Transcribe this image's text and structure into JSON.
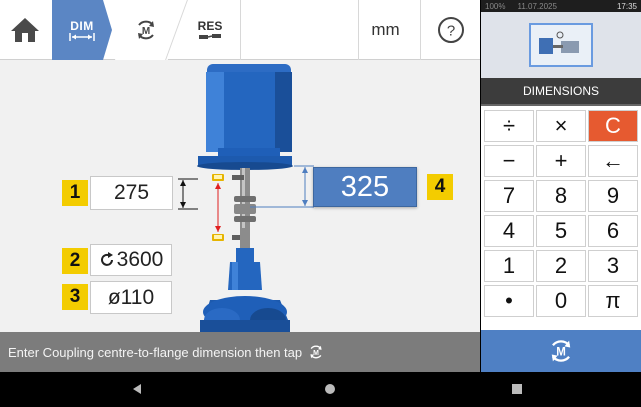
{
  "toolbar": {
    "home_icon": "home-icon",
    "dim_label": "DIM",
    "res_label": "RES",
    "unit": "mm",
    "help_label": "?"
  },
  "fields": [
    {
      "number": "1",
      "value": "275"
    },
    {
      "number": "2",
      "value": "3600"
    },
    {
      "number": "3",
      "value": "ø110"
    },
    {
      "number": "4",
      "value": "325"
    }
  ],
  "status_text": "Enter Coupling centre-to-flange dimension then tap",
  "right_panel": {
    "system": {
      "battery": "100%",
      "date": "11.07.2025",
      "time": "17:35"
    },
    "title": "DIMENSIONS",
    "keys": [
      "÷",
      "×",
      "C",
      "−",
      "+",
      "←",
      "7",
      "8",
      "9",
      "4",
      "5",
      "6",
      "1",
      "2",
      "3",
      "•",
      "0",
      "π"
    ]
  },
  "colors": {
    "accent_blue": "#4f7ec0",
    "badge_yellow": "#f3cc00",
    "clear_key": "#e65a30",
    "motor_blue": "#1f5fb8"
  }
}
